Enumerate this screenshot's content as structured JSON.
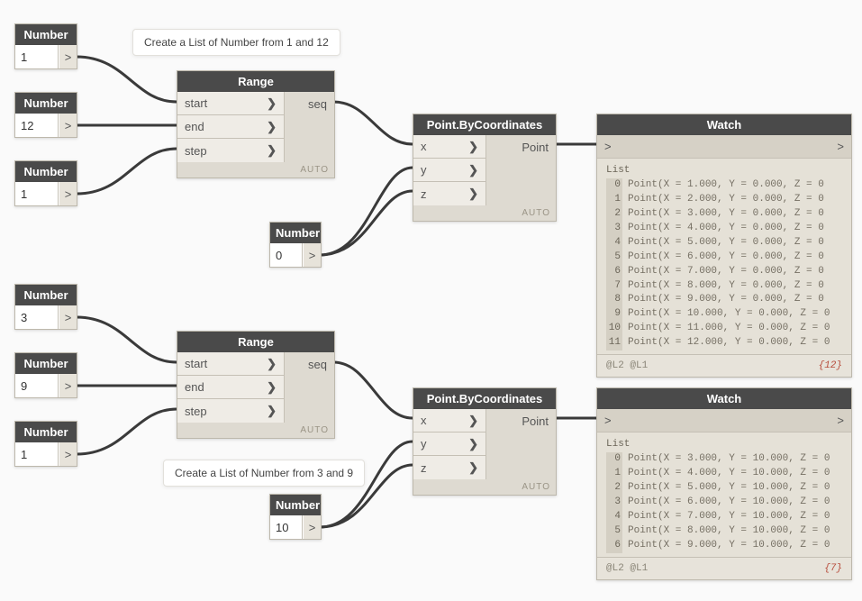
{
  "labels": {
    "number": "Number",
    "range": "Range",
    "point": "Point.ByCoordinates",
    "watch": "Watch",
    "auto": "AUTO",
    "list": "List",
    "chevron": ">",
    "lacing_label": "@L2 @L1"
  },
  "tooltips": {
    "t1": "Create a List of Number from 1 and 12",
    "t2": "Create a List of Number from 3 and 9"
  },
  "numbers": {
    "n1": "1",
    "n2": "12",
    "n3": "1",
    "n4": "0",
    "n5": "3",
    "n6": "9",
    "n7": "1",
    "n8": "10"
  },
  "range_ports": {
    "start": "start",
    "end": "end",
    "step": "step",
    "seq": "seq"
  },
  "point_ports": {
    "x": "x",
    "y": "y",
    "z": "z",
    "out": "Point"
  },
  "watch1": {
    "rows": [
      {
        "i": "0",
        "t": "Point(X = 1.000, Y = 0.000, Z = 0"
      },
      {
        "i": "1",
        "t": "Point(X = 2.000, Y = 0.000, Z = 0"
      },
      {
        "i": "2",
        "t": "Point(X = 3.000, Y = 0.000, Z = 0"
      },
      {
        "i": "3",
        "t": "Point(X = 4.000, Y = 0.000, Z = 0"
      },
      {
        "i": "4",
        "t": "Point(X = 5.000, Y = 0.000, Z = 0"
      },
      {
        "i": "5",
        "t": "Point(X = 6.000, Y = 0.000, Z = 0"
      },
      {
        "i": "6",
        "t": "Point(X = 7.000, Y = 0.000, Z = 0"
      },
      {
        "i": "7",
        "t": "Point(X = 8.000, Y = 0.000, Z = 0"
      },
      {
        "i": "8",
        "t": "Point(X = 9.000, Y = 0.000, Z = 0"
      },
      {
        "i": "9",
        "t": "Point(X = 10.000, Y = 0.000, Z = 0"
      },
      {
        "i": "10",
        "t": "Point(X = 11.000, Y = 0.000, Z = 0"
      },
      {
        "i": "11",
        "t": "Point(X = 12.000, Y = 0.000, Z = 0"
      }
    ],
    "count": "{12}"
  },
  "watch2": {
    "rows": [
      {
        "i": "0",
        "t": "Point(X = 3.000, Y = 10.000, Z = 0"
      },
      {
        "i": "1",
        "t": "Point(X = 4.000, Y = 10.000, Z = 0"
      },
      {
        "i": "2",
        "t": "Point(X = 5.000, Y = 10.000, Z = 0"
      },
      {
        "i": "3",
        "t": "Point(X = 6.000, Y = 10.000, Z = 0"
      },
      {
        "i": "4",
        "t": "Point(X = 7.000, Y = 10.000, Z = 0"
      },
      {
        "i": "5",
        "t": "Point(X = 8.000, Y = 10.000, Z = 0"
      },
      {
        "i": "6",
        "t": "Point(X = 9.000, Y = 10.000, Z = 0"
      }
    ],
    "count": "{7}"
  }
}
